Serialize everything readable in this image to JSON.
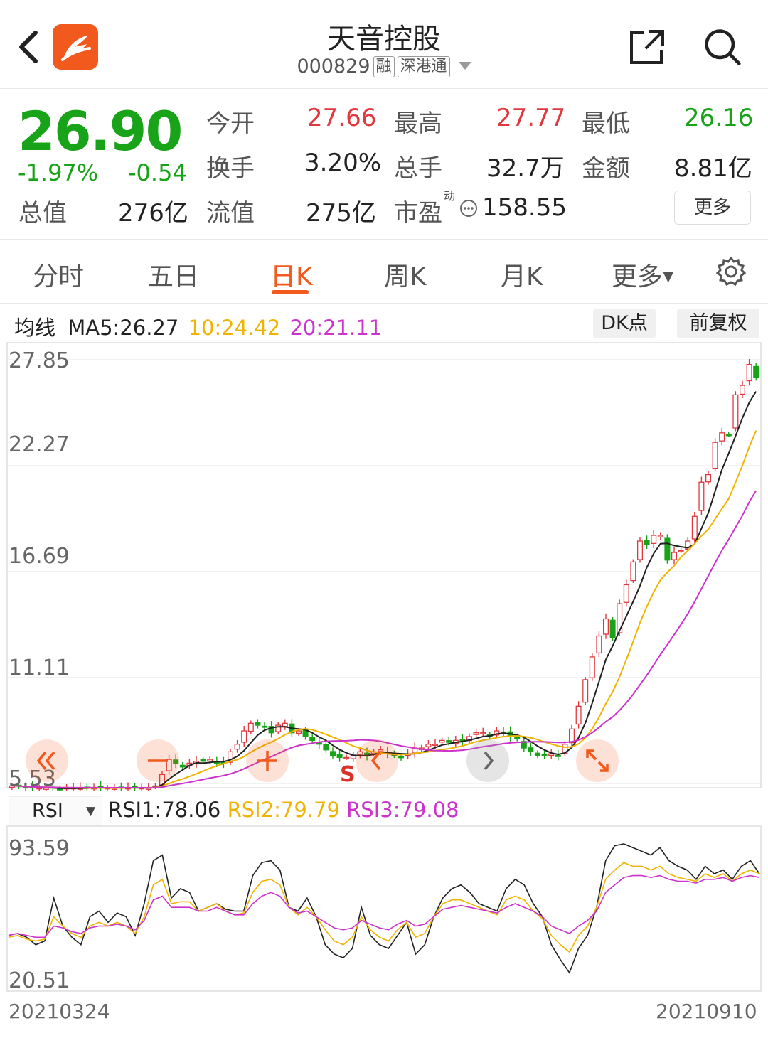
{
  "header": {
    "title": "天音控股",
    "code": "000829",
    "tag_margin": "融",
    "tag_connect": "深港通"
  },
  "quote": {
    "price": "26.90",
    "change_pct": "-1.97%",
    "change": "-0.54",
    "total_label": "总值",
    "total_value": "276亿",
    "rows": [
      [
        {
          "label": "今开",
          "value": "27.66",
          "color": "red"
        },
        {
          "label": "最高",
          "value": "27.77",
          "color": "red"
        },
        {
          "label": "最低",
          "value": "26.16",
          "color": "green"
        }
      ],
      [
        {
          "label": "换手",
          "value": "3.20%",
          "color": "plain"
        },
        {
          "label": "总手",
          "value": "32.7万",
          "color": "plain"
        },
        {
          "label": "金额",
          "value": "8.81亿",
          "color": "plain"
        }
      ],
      [
        {
          "label": "流值",
          "value": "275亿",
          "color": "plain"
        },
        {
          "label": "市盈",
          "value": "158.55",
          "color": "plain",
          "sup": "动"
        }
      ]
    ],
    "more_label": "更多"
  },
  "tabs": [
    "分时",
    "五日",
    "日K",
    "周K",
    "月K",
    "更多"
  ],
  "active_tab": "日K",
  "ma": {
    "label": "均线",
    "ma5": "MA5:26.27",
    "ma10": "10:24.42",
    "ma20": "20:21.11",
    "ma10_color": "#f0b400",
    "ma20_color": "#cc33cc",
    "dk_label": "DK点",
    "fq_label": "前复权"
  },
  "kline": {
    "y_ticks": [
      "27.85",
      "22.27",
      "16.69",
      "11.11",
      "5.53"
    ],
    "signal_label": "S"
  },
  "rsi": {
    "selector": "RSI",
    "rsi1": "RSI1:78.06",
    "rsi2": "RSI2:79.79",
    "rsi3": "RSI3:79.08",
    "y_top": "93.59",
    "y_bottom": "20.51"
  },
  "dates": {
    "start": "20210324",
    "end": "20210910"
  },
  "colors": {
    "up": "#e0383e",
    "down": "#19a319",
    "accent": "#f25a1d"
  },
  "chart_data": [
    {
      "type": "candlestick",
      "title": "",
      "ylim": [
        5.53,
        27.85
      ],
      "x_range": [
        "20210324",
        "20210910"
      ],
      "approx_close": [
        5.4,
        5.4,
        5.3,
        5.3,
        5.3,
        5.3,
        5.3,
        5.2,
        5.3,
        5.3,
        5.3,
        5.3,
        5.3,
        5.3,
        5.3,
        5.3,
        5.3,
        5.3,
        5.3,
        5.3,
        5.3,
        5.4,
        6.0,
        6.8,
        6.6,
        6.4,
        6.6,
        6.7,
        6.7,
        6.8,
        6.6,
        6.6,
        7.2,
        7.6,
        8.3,
        8.7,
        8.6,
        8.5,
        8.2,
        8.6,
        8.7,
        8.2,
        8.3,
        8.0,
        7.8,
        7.6,
        7.3,
        7.0,
        6.9,
        6.9,
        7.0,
        7.2,
        7.0,
        7.2,
        7.3,
        7.1,
        7.0,
        6.9,
        7.1,
        7.4,
        7.4,
        7.6,
        7.6,
        7.8,
        7.7,
        7.8,
        7.8,
        8.0,
        8.2,
        8.2,
        8.0,
        8.3,
        8.2,
        8.0,
        7.9,
        7.4,
        7.2,
        7.0,
        7.0,
        7.1,
        7.0,
        7.6,
        8.4,
        9.6,
        11.0,
        12.2,
        13.3,
        14.2,
        13.2,
        15.0,
        16.0,
        17.2,
        18.3,
        18.1,
        18.6,
        18.6,
        17.3,
        17.7,
        17.8,
        18.3,
        19.6,
        21.4,
        21.8,
        23.5,
        24.0,
        23.9,
        26.0,
        26.5,
        27.6,
        26.9
      ],
      "ma_series": [
        "MA5",
        "MA10",
        "MA20"
      ]
    },
    {
      "type": "line",
      "title": "",
      "ylim": [
        20.51,
        93.59
      ],
      "series": [
        {
          "name": "RSI1",
          "values": [
            45,
            46,
            44,
            40,
            42,
            65,
            50,
            44,
            40,
            55,
            58,
            52,
            57,
            55,
            45,
            62,
            85,
            88,
            65,
            70,
            68,
            58,
            60,
            62,
            59,
            58,
            58,
            77,
            84,
            85,
            80,
            60,
            58,
            65,
            55,
            40,
            35,
            33,
            38,
            60,
            45,
            40,
            38,
            45,
            52,
            35,
            40,
            55,
            65,
            70,
            72,
            68,
            62,
            60,
            58,
            70,
            75,
            72,
            62,
            55,
            40,
            32,
            25,
            38,
            45,
            60,
            85,
            93,
            94,
            92,
            90,
            88,
            92,
            85,
            82,
            80,
            75,
            82,
            78,
            80,
            75,
            82,
            85,
            78
          ]
        },
        {
          "name": "RSI2",
          "values": [
            44,
            45,
            43,
            42,
            43,
            55,
            50,
            46,
            44,
            50,
            52,
            50,
            52,
            50,
            46,
            55,
            72,
            75,
            62,
            63,
            63,
            58,
            60,
            62,
            58,
            56,
            57,
            68,
            74,
            75,
            72,
            60,
            56,
            60,
            55,
            48,
            42,
            40,
            44,
            55,
            48,
            44,
            42,
            48,
            52,
            44,
            46,
            55,
            62,
            64,
            64,
            62,
            60,
            58,
            56,
            64,
            66,
            64,
            58,
            54,
            45,
            40,
            36,
            45,
            50,
            60,
            75,
            80,
            84,
            82,
            82,
            80,
            82,
            78,
            76,
            75,
            74,
            78,
            76,
            78,
            74,
            78,
            80,
            78
          ]
        },
        {
          "name": "RSI3",
          "values": [
            45,
            46,
            45,
            44,
            44,
            50,
            49,
            47,
            46,
            49,
            50,
            50,
            51,
            50,
            48,
            53,
            64,
            66,
            60,
            60,
            60,
            58,
            58,
            60,
            58,
            56,
            56,
            62,
            66,
            68,
            66,
            60,
            57,
            58,
            55,
            52,
            49,
            48,
            49,
            53,
            51,
            49,
            48,
            51,
            53,
            50,
            51,
            55,
            59,
            60,
            61,
            60,
            59,
            58,
            57,
            60,
            62,
            60,
            58,
            55,
            50,
            48,
            46,
            50,
            53,
            58,
            68,
            72,
            76,
            77,
            77,
            76,
            77,
            75,
            74,
            74,
            73,
            75,
            75,
            76,
            74,
            76,
            77,
            76
          ]
        }
      ]
    }
  ]
}
